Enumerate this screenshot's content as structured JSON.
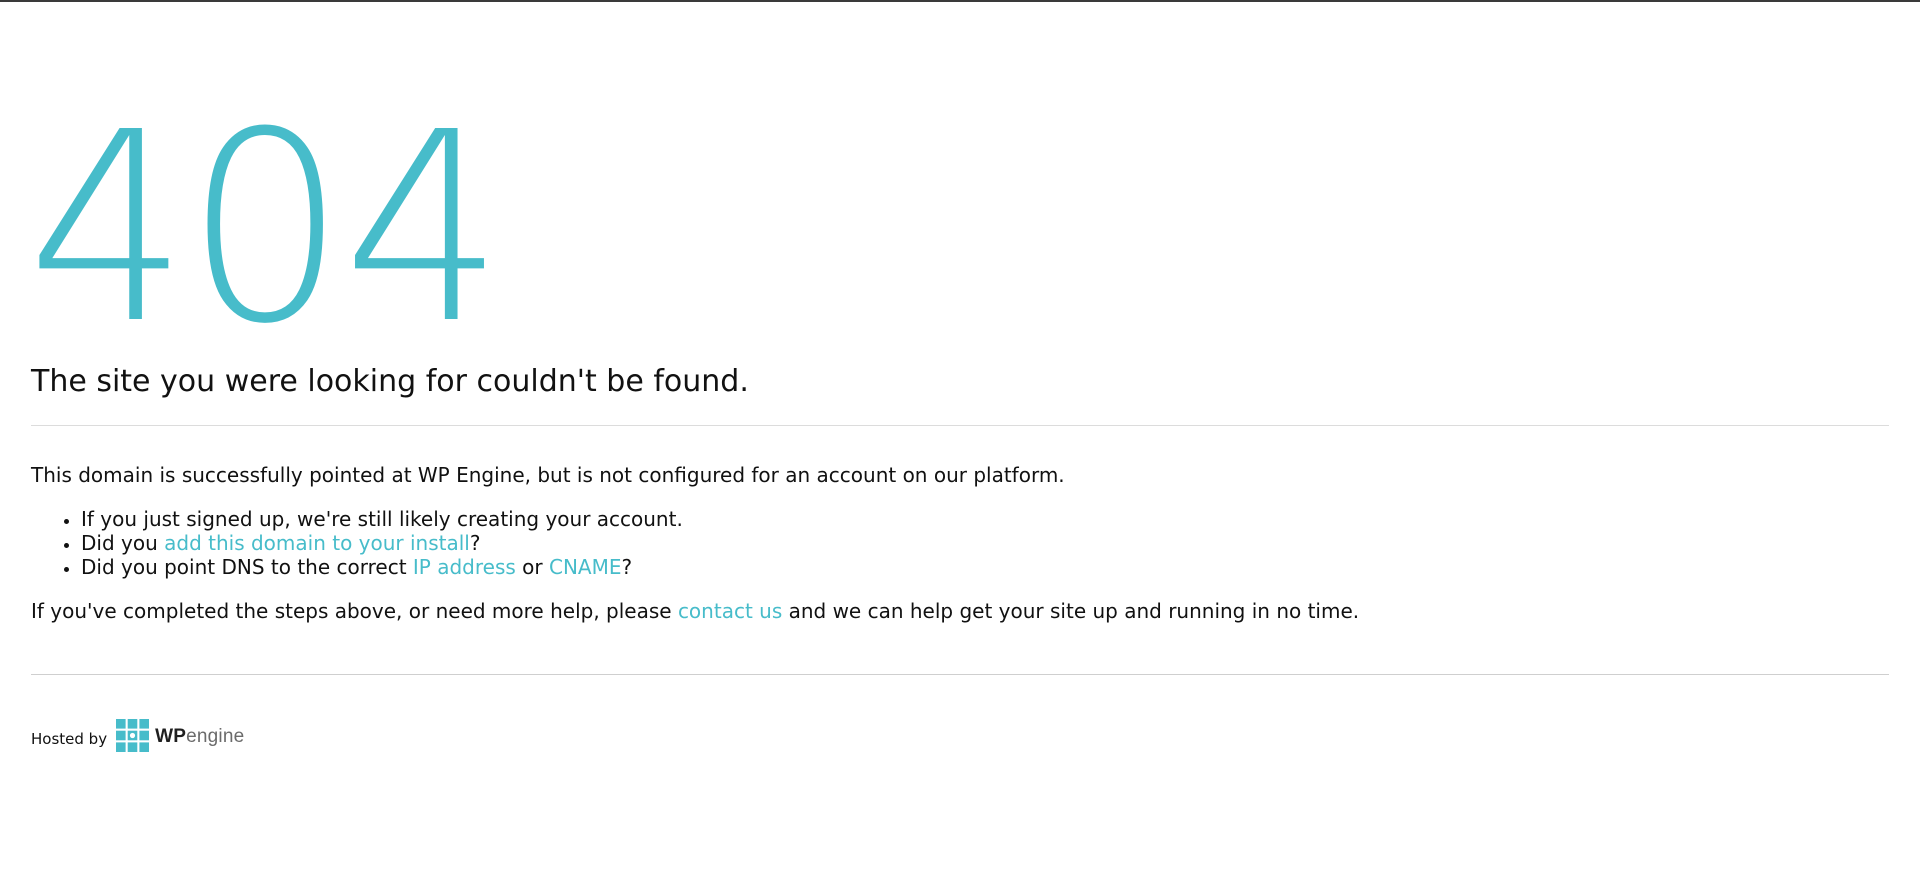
{
  "error": {
    "code": "404",
    "headline": "The site you were looking for couldn't be found."
  },
  "body": {
    "lead": "This domain is successfully pointed at WP Engine, but is not configured for an account on our platform.",
    "items": [
      {
        "text": "If you just signed up, we're still likely creating your account."
      },
      {
        "prefix": "Did you ",
        "link": "add this domain to your install",
        "suffix": "?"
      },
      {
        "prefix": "Did you point DNS to the correct ",
        "link1": "IP address",
        "middle": " or ",
        "link2": "CNAME",
        "suffix": "?"
      }
    ],
    "closing": {
      "prefix": "If you've completed the steps above, or need more help, please ",
      "link": "contact us",
      "suffix": " and we can help get your site up and running in no time."
    }
  },
  "footer": {
    "hosted_by": "Hosted by",
    "logo_bold": "WP",
    "logo_light": "engine",
    "logo_icon": "wpengine-grid-logo-icon"
  },
  "colors": {
    "accent": "#47bcca",
    "text": "#111111",
    "divider": "#dcdcdc"
  }
}
